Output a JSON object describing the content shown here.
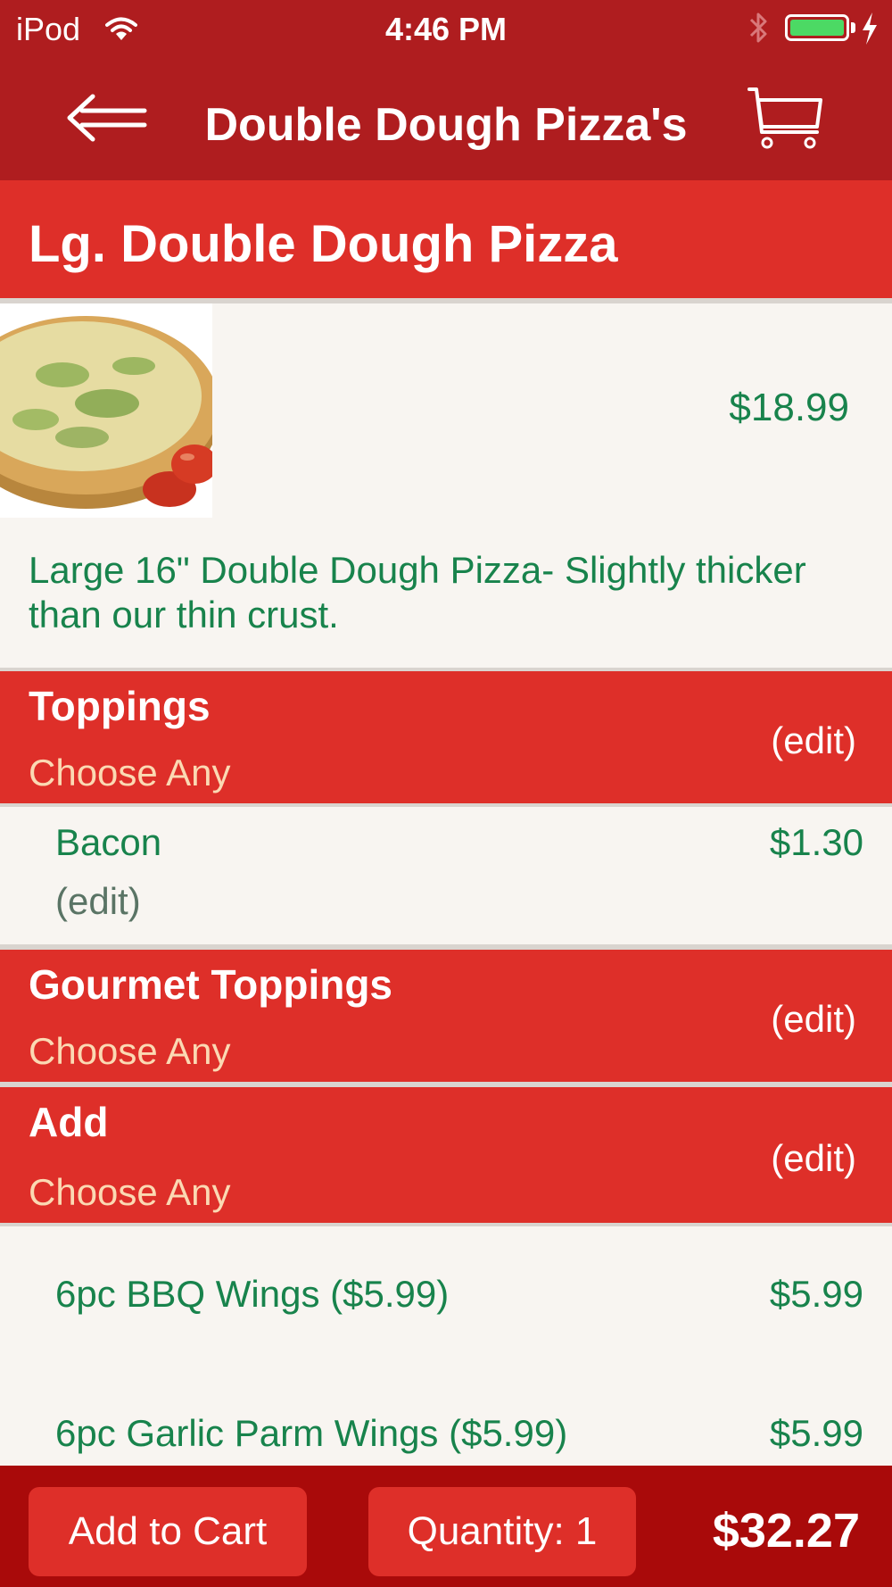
{
  "status_bar": {
    "carrier": "iPod",
    "time": "4:46 PM",
    "icons": [
      "wifi-icon",
      "bluetooth-icon",
      "battery-icon",
      "charging-icon"
    ],
    "battery_level": 1.0
  },
  "nav": {
    "title": "Double Dough Pizza's",
    "back_icon": "arrow-left-icon",
    "cart_icon": "shopping-cart-icon"
  },
  "item": {
    "name": "Lg. Double Dough Pizza",
    "price": "$18.99",
    "description": "Large 16\" Double Dough Pizza- Slightly thicker than our thin crust."
  },
  "groups": [
    {
      "title": "Toppings",
      "subtitle": "Choose Any",
      "edit_label": "(edit)",
      "selections": [
        {
          "name": "Bacon",
          "price": "$1.30",
          "edit_label": "(edit)"
        }
      ]
    },
    {
      "title": "Gourmet Toppings",
      "subtitle": "Choose Any",
      "edit_label": "(edit)",
      "selections": []
    },
    {
      "title": "Add",
      "subtitle": "Choose Any",
      "edit_label": "(edit)",
      "selections": [
        {
          "name": "6pc BBQ Wings ($5.99)",
          "price": "$5.99"
        },
        {
          "name": "6pc Garlic Parm Wings ($5.99)",
          "price": "$5.99"
        }
      ]
    }
  ],
  "footer": {
    "add_to_cart_label": "Add to Cart",
    "quantity_label": "Quantity: 1",
    "total": "$32.27"
  },
  "colors": {
    "bar_red": "#af1d1f",
    "accent_red": "#de2f29",
    "footer_red": "#a90a0a",
    "text_green": "#18834c",
    "subtitle_cream": "#fbd9b3",
    "background": "#f8f5f1"
  }
}
